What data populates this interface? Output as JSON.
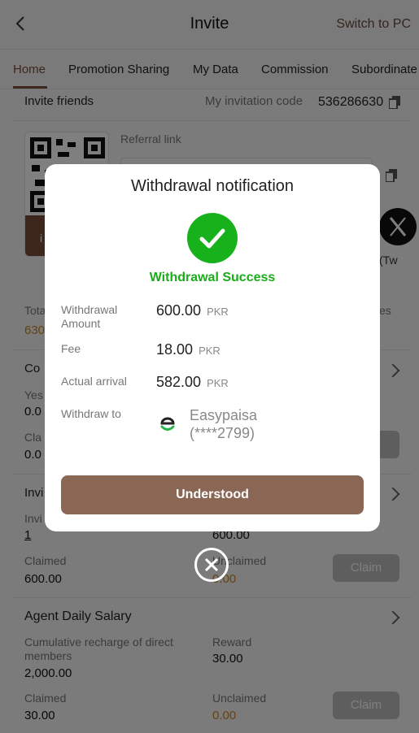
{
  "header": {
    "title": "Invite",
    "switch_label": "Switch to PC"
  },
  "tabs": [
    "Home",
    "Promotion Sharing",
    "My Data",
    "Commission",
    "Subordinate"
  ],
  "invite": {
    "title": "Invite friends",
    "code_label": "My invitation code",
    "code_value": "536286630",
    "referral_label": "Referral link",
    "qr_button_fragment": "i",
    "share_fragment": "(Tw"
  },
  "stats": {
    "total_fragment": "Tota",
    "total_value_fragment": "630",
    "right_fragment": "es"
  },
  "commission": {
    "title_fragment": "Co",
    "yesterday_fragment": "Yes",
    "yesterday_value_fragment": "0.0",
    "claimed_fragment": "Cla",
    "claimed_value_fragment": "0.0"
  },
  "invitation_reward": {
    "title_fragment": "Invi",
    "count_label_fragment": "Invi",
    "count_value": "1",
    "reward_value": "600.00",
    "claimed_label": "Claimed",
    "claimed_value": "600.00",
    "unclaimed_label": "Unclaimed",
    "unclaimed_value": "0.00",
    "claim_label": "Claim"
  },
  "agent_salary": {
    "title": "Agent Daily Salary",
    "recharge_label": "Cumulative recharge of direct members",
    "recharge_value": "2,000.00",
    "reward_label": "Reward",
    "reward_value": "30.00",
    "claimed_label": "Claimed",
    "claimed_value": "30.00",
    "unclaimed_label": "Unclaimed",
    "unclaimed_value": "0.00",
    "claim_label": "Claim"
  },
  "modal": {
    "title": "Withdrawal notification",
    "status": "Withdrawal Success",
    "amount_label": "Withdrawal Amount",
    "amount_value": "600.00",
    "fee_label": "Fee",
    "fee_value": "18.00",
    "arrival_label": "Actual arrival",
    "arrival_value": "582.00",
    "currency": "PKR",
    "withdraw_to_label": "Withdraw to",
    "method_name": "Easypaisa",
    "method_account": "(****2799)",
    "button_label": "Understood"
  },
  "colors": {
    "accent": "#7a4f3a",
    "success": "#16b11b",
    "button": "#8a6654",
    "orange": "#c8841e"
  }
}
